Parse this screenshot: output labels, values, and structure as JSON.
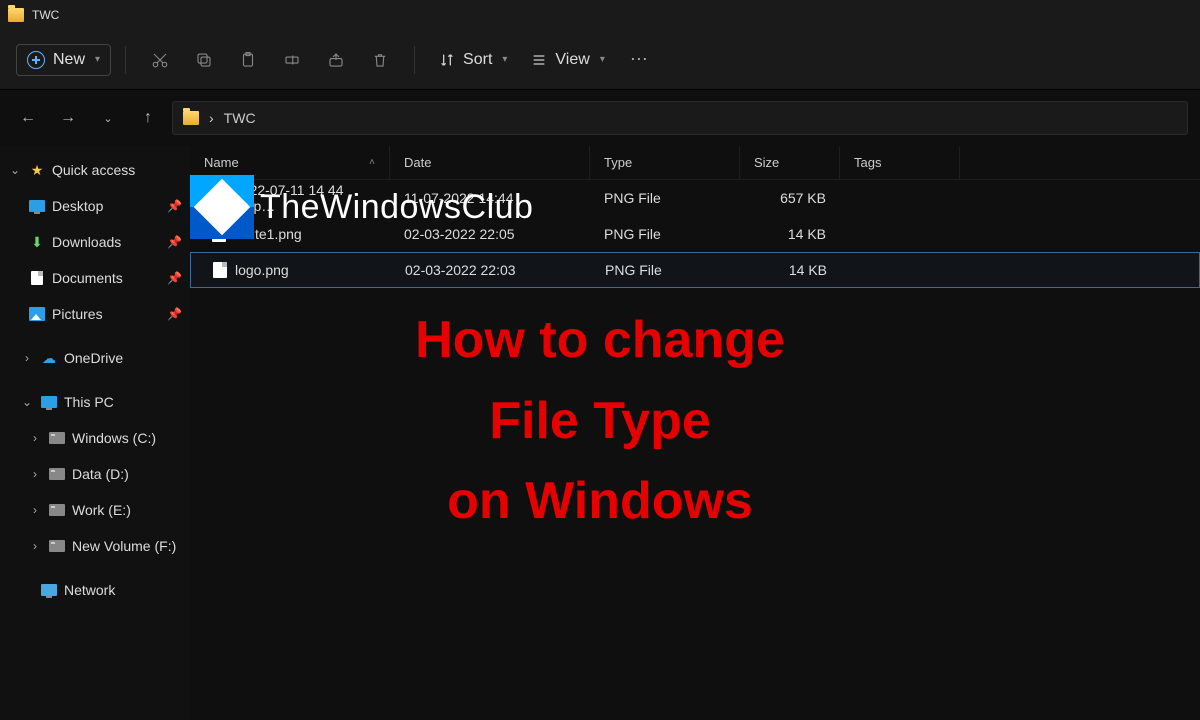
{
  "title": "TWC",
  "toolbar": {
    "new_label": "New",
    "sort_label": "Sort",
    "view_label": "View"
  },
  "breadcrumb": {
    "sep": "›",
    "current": "TWC"
  },
  "sidebar": {
    "quick": "Quick access",
    "desktop": "Desktop",
    "downloads": "Downloads",
    "documents": "Documents",
    "pictures": "Pictures",
    "onedrive": "OneDrive",
    "thispc": "This PC",
    "drive_c": "Windows (C:)",
    "drive_d": "Data (D:)",
    "drive_e": "Work (E:)",
    "drive_f": "New Volume (F:)",
    "network": "Network"
  },
  "columns": {
    "name": "Name",
    "date": "Date",
    "type": "Type",
    "size": "Size",
    "tags": "Tags"
  },
  "files": [
    {
      "name": "2022-07-11 14 44 19.p…",
      "date": "11-07-2022 14:44",
      "type": "PNG File",
      "size": "657 KB"
    },
    {
      "name": "white1.png",
      "date": "02-03-2022 22:05",
      "type": "PNG File",
      "size": "14 KB"
    },
    {
      "name": "logo.png",
      "date": "02-03-2022 22:03",
      "type": "PNG File",
      "size": "14 KB"
    }
  ],
  "watermark": "TheWindowsClub",
  "headline": {
    "l1": "How to change",
    "l2": "File Type",
    "l3": "on Windows"
  }
}
